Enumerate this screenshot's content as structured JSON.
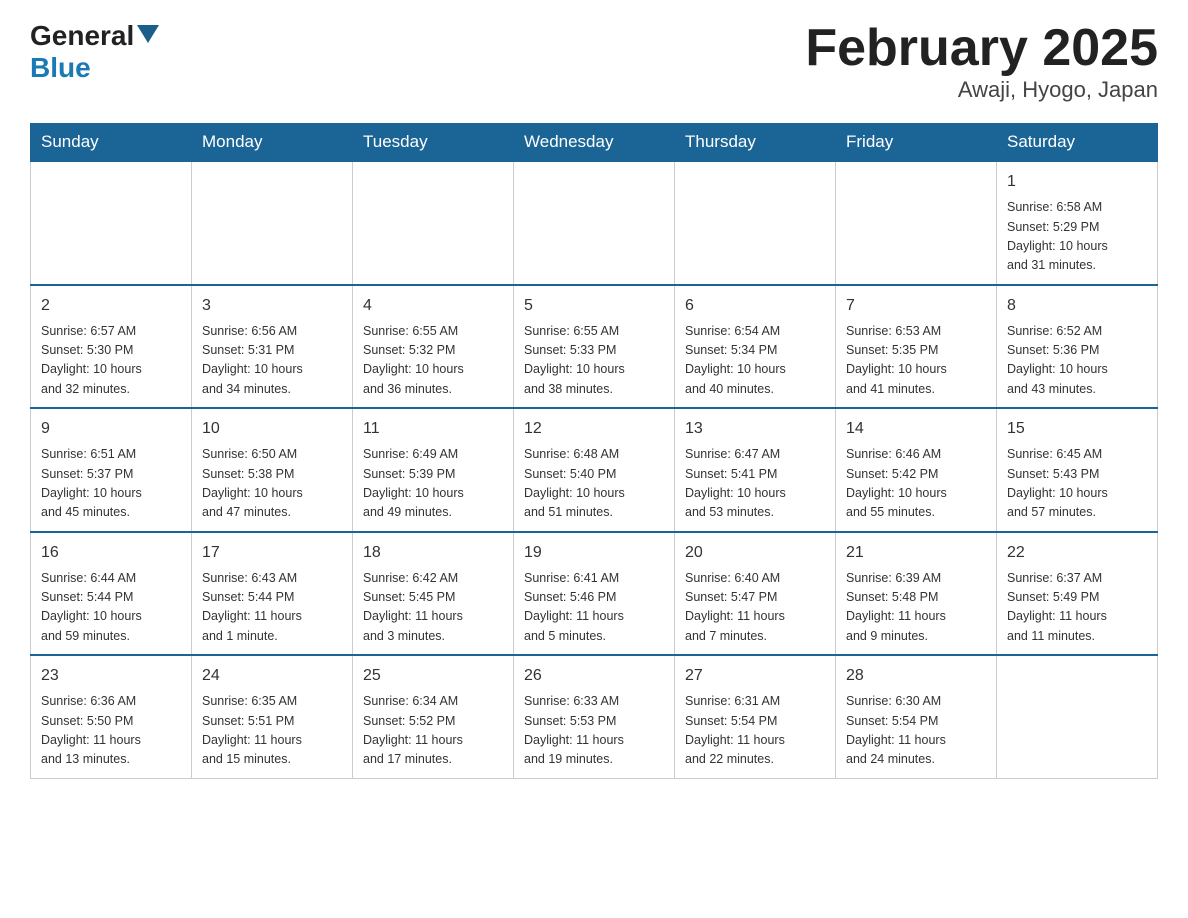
{
  "header": {
    "logo_general": "General",
    "logo_blue": "Blue",
    "month_title": "February 2025",
    "location": "Awaji, Hyogo, Japan"
  },
  "days_of_week": [
    "Sunday",
    "Monday",
    "Tuesday",
    "Wednesday",
    "Thursday",
    "Friday",
    "Saturday"
  ],
  "weeks": [
    [
      {
        "day": "",
        "info": ""
      },
      {
        "day": "",
        "info": ""
      },
      {
        "day": "",
        "info": ""
      },
      {
        "day": "",
        "info": ""
      },
      {
        "day": "",
        "info": ""
      },
      {
        "day": "",
        "info": ""
      },
      {
        "day": "1",
        "info": "Sunrise: 6:58 AM\nSunset: 5:29 PM\nDaylight: 10 hours\nand 31 minutes."
      }
    ],
    [
      {
        "day": "2",
        "info": "Sunrise: 6:57 AM\nSunset: 5:30 PM\nDaylight: 10 hours\nand 32 minutes."
      },
      {
        "day": "3",
        "info": "Sunrise: 6:56 AM\nSunset: 5:31 PM\nDaylight: 10 hours\nand 34 minutes."
      },
      {
        "day": "4",
        "info": "Sunrise: 6:55 AM\nSunset: 5:32 PM\nDaylight: 10 hours\nand 36 minutes."
      },
      {
        "day": "5",
        "info": "Sunrise: 6:55 AM\nSunset: 5:33 PM\nDaylight: 10 hours\nand 38 minutes."
      },
      {
        "day": "6",
        "info": "Sunrise: 6:54 AM\nSunset: 5:34 PM\nDaylight: 10 hours\nand 40 minutes."
      },
      {
        "day": "7",
        "info": "Sunrise: 6:53 AM\nSunset: 5:35 PM\nDaylight: 10 hours\nand 41 minutes."
      },
      {
        "day": "8",
        "info": "Sunrise: 6:52 AM\nSunset: 5:36 PM\nDaylight: 10 hours\nand 43 minutes."
      }
    ],
    [
      {
        "day": "9",
        "info": "Sunrise: 6:51 AM\nSunset: 5:37 PM\nDaylight: 10 hours\nand 45 minutes."
      },
      {
        "day": "10",
        "info": "Sunrise: 6:50 AM\nSunset: 5:38 PM\nDaylight: 10 hours\nand 47 minutes."
      },
      {
        "day": "11",
        "info": "Sunrise: 6:49 AM\nSunset: 5:39 PM\nDaylight: 10 hours\nand 49 minutes."
      },
      {
        "day": "12",
        "info": "Sunrise: 6:48 AM\nSunset: 5:40 PM\nDaylight: 10 hours\nand 51 minutes."
      },
      {
        "day": "13",
        "info": "Sunrise: 6:47 AM\nSunset: 5:41 PM\nDaylight: 10 hours\nand 53 minutes."
      },
      {
        "day": "14",
        "info": "Sunrise: 6:46 AM\nSunset: 5:42 PM\nDaylight: 10 hours\nand 55 minutes."
      },
      {
        "day": "15",
        "info": "Sunrise: 6:45 AM\nSunset: 5:43 PM\nDaylight: 10 hours\nand 57 minutes."
      }
    ],
    [
      {
        "day": "16",
        "info": "Sunrise: 6:44 AM\nSunset: 5:44 PM\nDaylight: 10 hours\nand 59 minutes."
      },
      {
        "day": "17",
        "info": "Sunrise: 6:43 AM\nSunset: 5:44 PM\nDaylight: 11 hours\nand 1 minute."
      },
      {
        "day": "18",
        "info": "Sunrise: 6:42 AM\nSunset: 5:45 PM\nDaylight: 11 hours\nand 3 minutes."
      },
      {
        "day": "19",
        "info": "Sunrise: 6:41 AM\nSunset: 5:46 PM\nDaylight: 11 hours\nand 5 minutes."
      },
      {
        "day": "20",
        "info": "Sunrise: 6:40 AM\nSunset: 5:47 PM\nDaylight: 11 hours\nand 7 minutes."
      },
      {
        "day": "21",
        "info": "Sunrise: 6:39 AM\nSunset: 5:48 PM\nDaylight: 11 hours\nand 9 minutes."
      },
      {
        "day": "22",
        "info": "Sunrise: 6:37 AM\nSunset: 5:49 PM\nDaylight: 11 hours\nand 11 minutes."
      }
    ],
    [
      {
        "day": "23",
        "info": "Sunrise: 6:36 AM\nSunset: 5:50 PM\nDaylight: 11 hours\nand 13 minutes."
      },
      {
        "day": "24",
        "info": "Sunrise: 6:35 AM\nSunset: 5:51 PM\nDaylight: 11 hours\nand 15 minutes."
      },
      {
        "day": "25",
        "info": "Sunrise: 6:34 AM\nSunset: 5:52 PM\nDaylight: 11 hours\nand 17 minutes."
      },
      {
        "day": "26",
        "info": "Sunrise: 6:33 AM\nSunset: 5:53 PM\nDaylight: 11 hours\nand 19 minutes."
      },
      {
        "day": "27",
        "info": "Sunrise: 6:31 AM\nSunset: 5:54 PM\nDaylight: 11 hours\nand 22 minutes."
      },
      {
        "day": "28",
        "info": "Sunrise: 6:30 AM\nSunset: 5:54 PM\nDaylight: 11 hours\nand 24 minutes."
      },
      {
        "day": "",
        "info": ""
      }
    ]
  ]
}
